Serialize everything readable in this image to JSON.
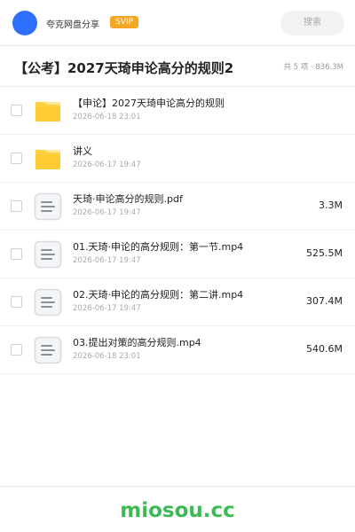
{
  "header": {
    "brand": "夸克网盘分享",
    "badge": "SVIP",
    "search_placeholder": "搜索",
    "avatar_color": "#2f6fff",
    "badge_color": "#f5a623"
  },
  "share": {
    "title": "【公考】2027天琦申论高分的规则2",
    "meta": "共 5 项 · 836.3M"
  },
  "files": [
    {
      "name": "【申论】2027天琦申论高分的规则",
      "date": "2026-06-18 23:01",
      "size": "",
      "icon": "folder-icon"
    },
    {
      "name": "讲义",
      "date": "2026-06-17 19:47",
      "size": "",
      "icon": "folder-icon"
    },
    {
      "name": "天琦·申论高分的规则.pdf",
      "date": "2026-06-17 19:47",
      "size": "3.3M",
      "icon": "document-icon"
    },
    {
      "name": "01.天琦·申论的高分规则：第一节.mp4",
      "date": "2026-06-17 19:47",
      "size": "525.5M",
      "icon": "document-icon"
    },
    {
      "name": "02.天琦·申论的高分规则：第二讲.mp4",
      "date": "2026-06-17 19:47",
      "size": "307.4M",
      "icon": "document-icon"
    },
    {
      "name": "03.提出对策的高分规则.mp4",
      "date": "2026-06-18 23:01",
      "size": "540.6M",
      "icon": "document-icon"
    }
  ],
  "footer": {
    "logo": "miosou.cc",
    "logo_color": "#3cba54"
  }
}
